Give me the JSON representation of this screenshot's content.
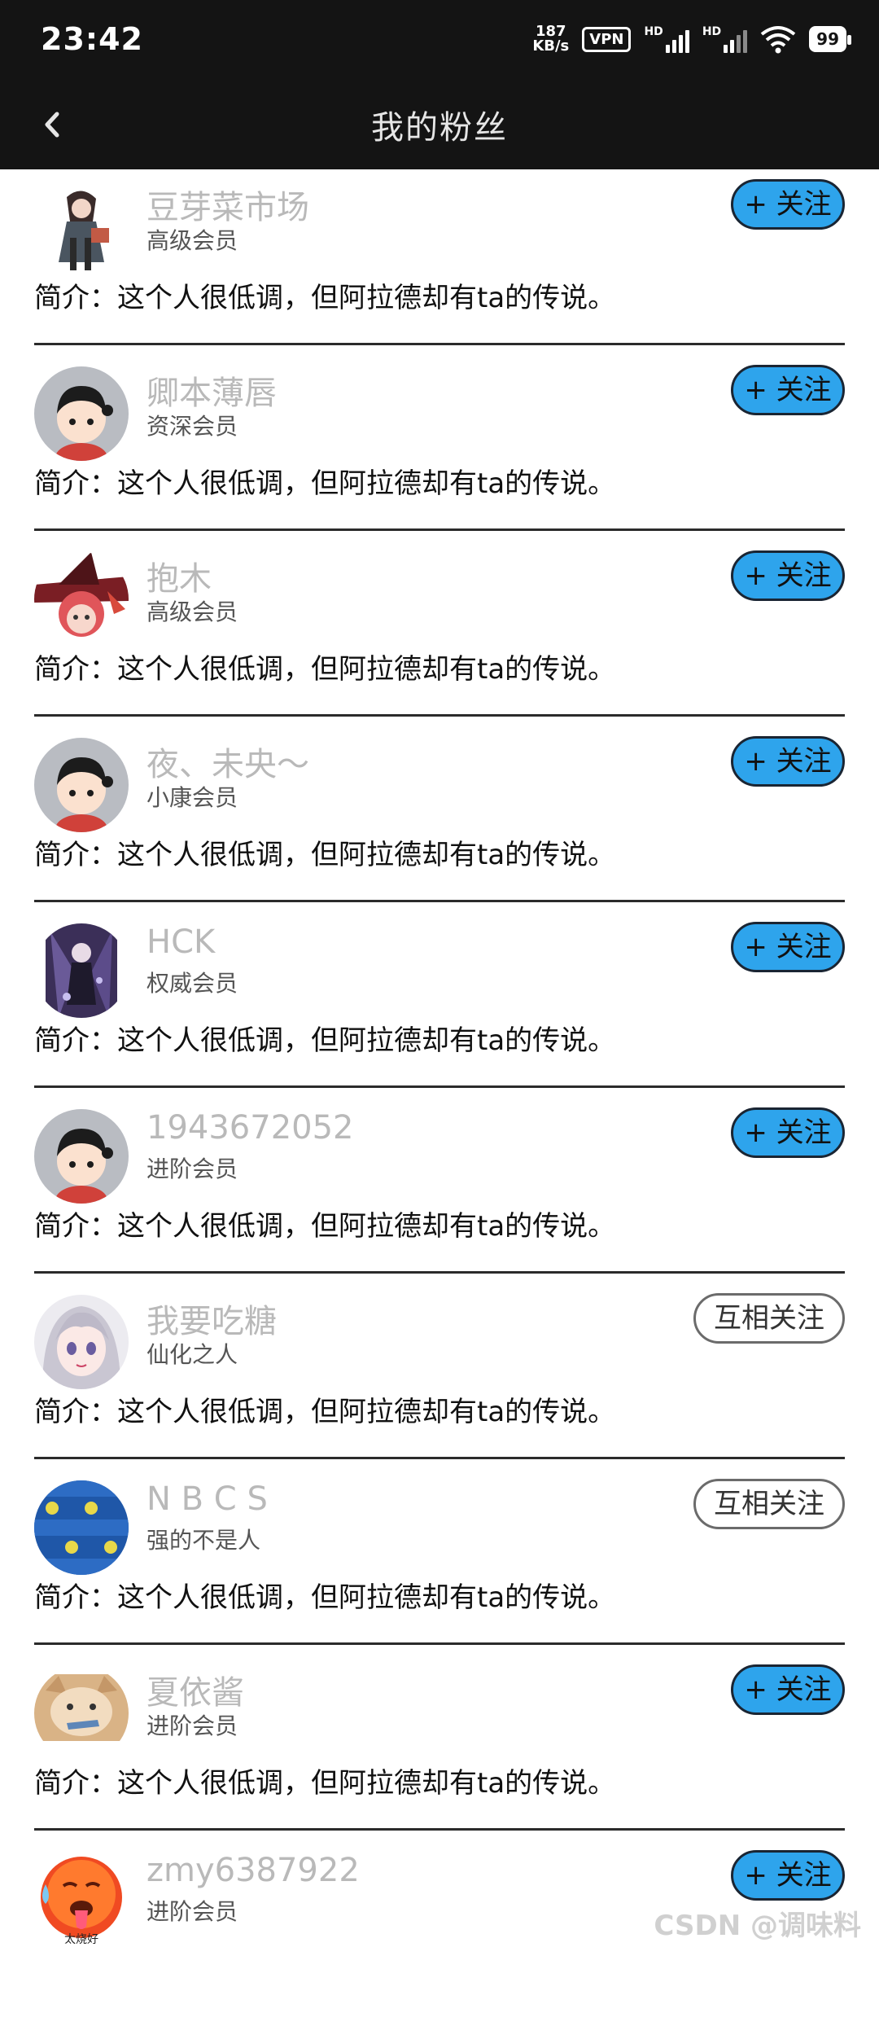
{
  "status_bar": {
    "time": "23:42",
    "net_speed_value": "187",
    "net_speed_unit": "KB/s",
    "vpn": "VPN",
    "signal1_label": "HD",
    "signal2_label": "HD",
    "battery": "99"
  },
  "header": {
    "title": "我的粉丝"
  },
  "fans": [
    {
      "name": "豆芽菜市场",
      "level": "高级会员",
      "intro": "简介：这个人很低调，但阿拉德却有ta的传说。",
      "button": "+ 关注",
      "avatar": "anime-girl-avatar"
    },
    {
      "name": "卿本薄唇",
      "level": "资深会员",
      "intro": "简介：这个人很低调，但阿拉德却有ta的传说。",
      "button": "+ 关注",
      "avatar": "default-cartoon-avatar"
    },
    {
      "name": "抱木",
      "level": "高级会员",
      "intro": "简介：这个人很低调，但阿拉德却有ta的传说。",
      "button": "+ 关注",
      "avatar": "witch-hat-avatar"
    },
    {
      "name": "夜、未央～",
      "level": "小康会员",
      "intro": "简介：这个人很低调，但阿拉德却有ta的传说。",
      "button": "+ 关注",
      "avatar": "default-cartoon-avatar"
    },
    {
      "name": "HCK",
      "level": "权威会员",
      "intro": "简介：这个人很低调，但阿拉德却有ta的传说。",
      "button": "+ 关注",
      "avatar": "dark-anime-avatar"
    },
    {
      "name": "1943672052",
      "level": "进阶会员",
      "intro": "简介：这个人很低调，但阿拉德却有ta的传说。",
      "button": "+ 关注",
      "avatar": "default-cartoon-avatar"
    },
    {
      "name": "我要吃糖",
      "level": "仙化之人",
      "intro": "简介：这个人很低调，但阿拉德却有ta的传说。",
      "button": "互相关注",
      "avatar": "silver-hair-avatar"
    },
    {
      "name": "N B  C S",
      "level": "强的不是人",
      "intro": "简介：这个人很低调，但阿拉德却有ta的传说。",
      "button": "互相关注",
      "avatar": "blue-pattern-avatar"
    },
    {
      "name": "夏依酱",
      "level": "进阶会员",
      "intro": "简介：这个人很低调，但阿拉德却有ta的传说。",
      "button": "+ 关注",
      "avatar": "cat-avatar"
    },
    {
      "name": "zmy6387922",
      "level": "进阶会员",
      "intro": "",
      "button": "+ 关注",
      "avatar": "hot-face-emoji-avatar",
      "avatar_caption": "太烧好"
    }
  ],
  "watermark": "CSDN @调味料",
  "colors": {
    "header_bg": "#141414",
    "follow_button": "#2ea4ec",
    "name_text": "#b9b9b9"
  }
}
